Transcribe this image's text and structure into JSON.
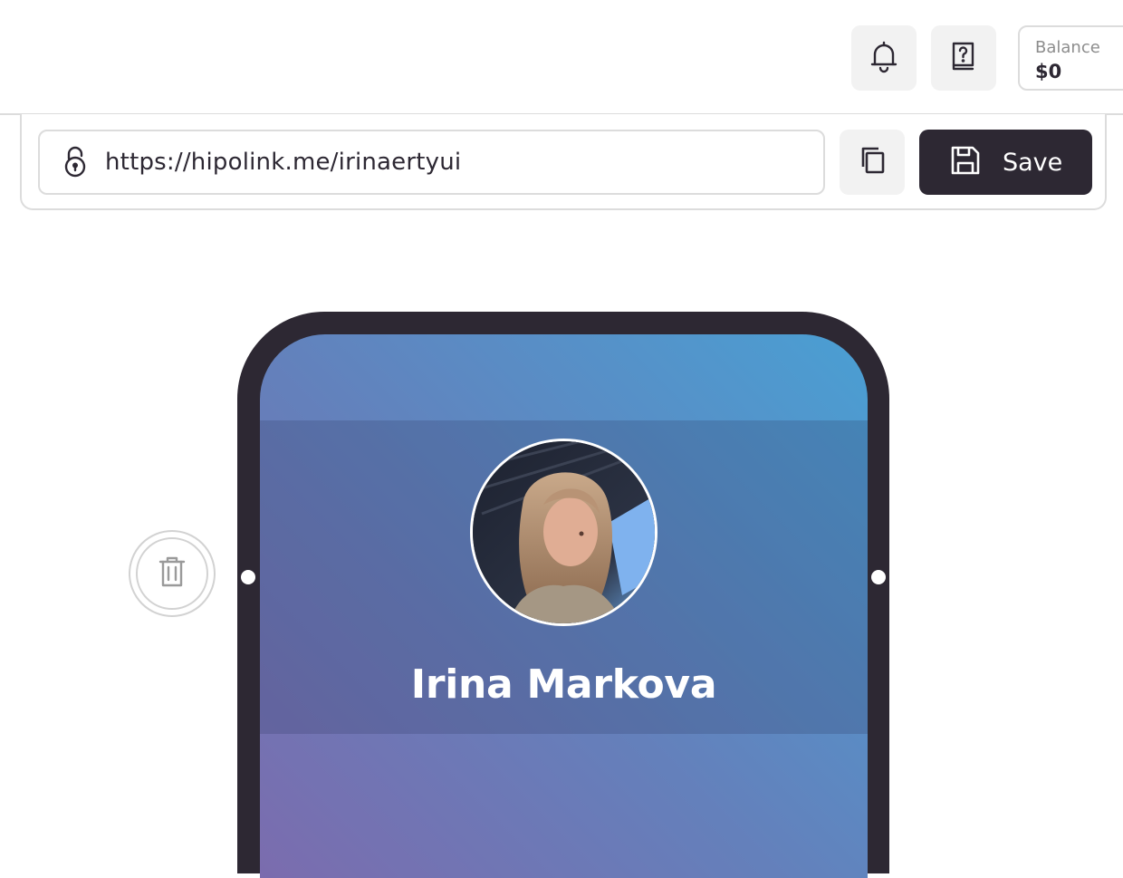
{
  "header": {
    "notifications_icon": "bell-icon",
    "help_icon": "help-book-icon",
    "balance": {
      "label": "Balance",
      "value": "$0"
    }
  },
  "url_bar": {
    "url": "https://hipolink.me/irinaertyui",
    "lock_icon": "lock-icon",
    "copy_icon": "copy-icon",
    "save_label": "Save",
    "save_icon": "floppy-disk-icon"
  },
  "editor": {
    "delete_icon": "trash-icon"
  },
  "preview": {
    "profile_name": "Irina Markova",
    "colors": {
      "frame": "#2d2833",
      "gradient_start": "#7b6cae",
      "gradient_end": "#4a9fd3"
    }
  }
}
